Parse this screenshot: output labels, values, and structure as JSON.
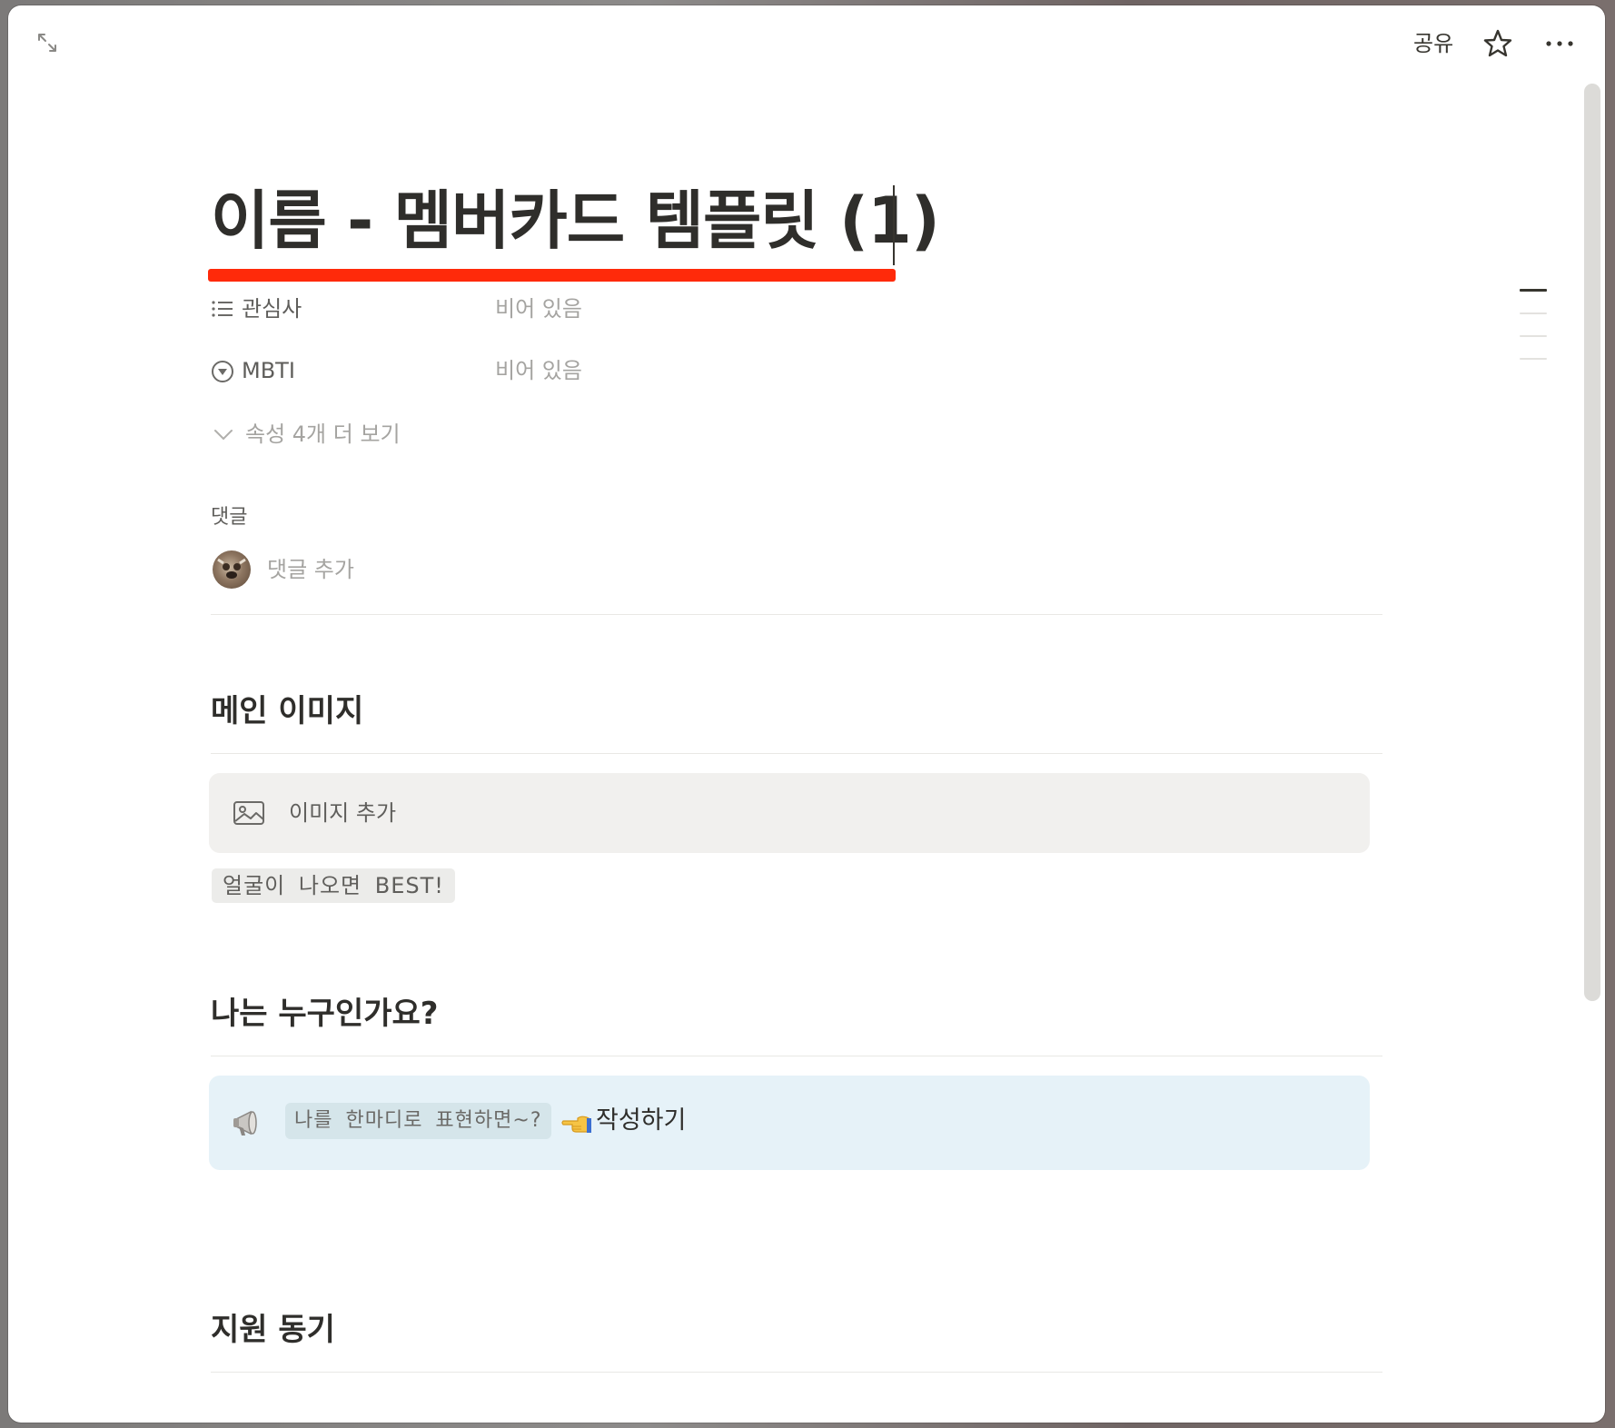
{
  "topbar": {
    "expand_icon": "expand-arrows-icon",
    "share_label": "공유",
    "star_icon": "star-icon",
    "more_icon": "more-horizontal-icon"
  },
  "page": {
    "title": "이름 - 멤버카드 템플릿 (1)",
    "highlight_color": "#ff2a0a"
  },
  "properties": [
    {
      "icon": "list-icon",
      "name": "관심사",
      "value": "비어 있음"
    },
    {
      "icon": "select-icon",
      "name": "MBTI",
      "value": "비어 있음"
    }
  ],
  "more_properties": {
    "icon": "chevron-down-icon",
    "label": "속성 4개 더 보기"
  },
  "comments": {
    "label": "댓글",
    "placeholder": "댓글 추가"
  },
  "sections": {
    "main_image": {
      "heading": "메인 이미지",
      "add_image_label": "이미지 추가",
      "hint": "얼굴이 나오면 BEST!"
    },
    "who_am_i": {
      "heading": "나는 누구인가요?",
      "callout_icon": "megaphone-icon",
      "callout_code": "나를 한마디로 표현하면~?",
      "callout_hand_icon": "pointing-left-hand-icon",
      "callout_text": "작성하기",
      "callout_bg": "#e6f2f8"
    },
    "motivation": {
      "heading": "지원 동기"
    }
  }
}
